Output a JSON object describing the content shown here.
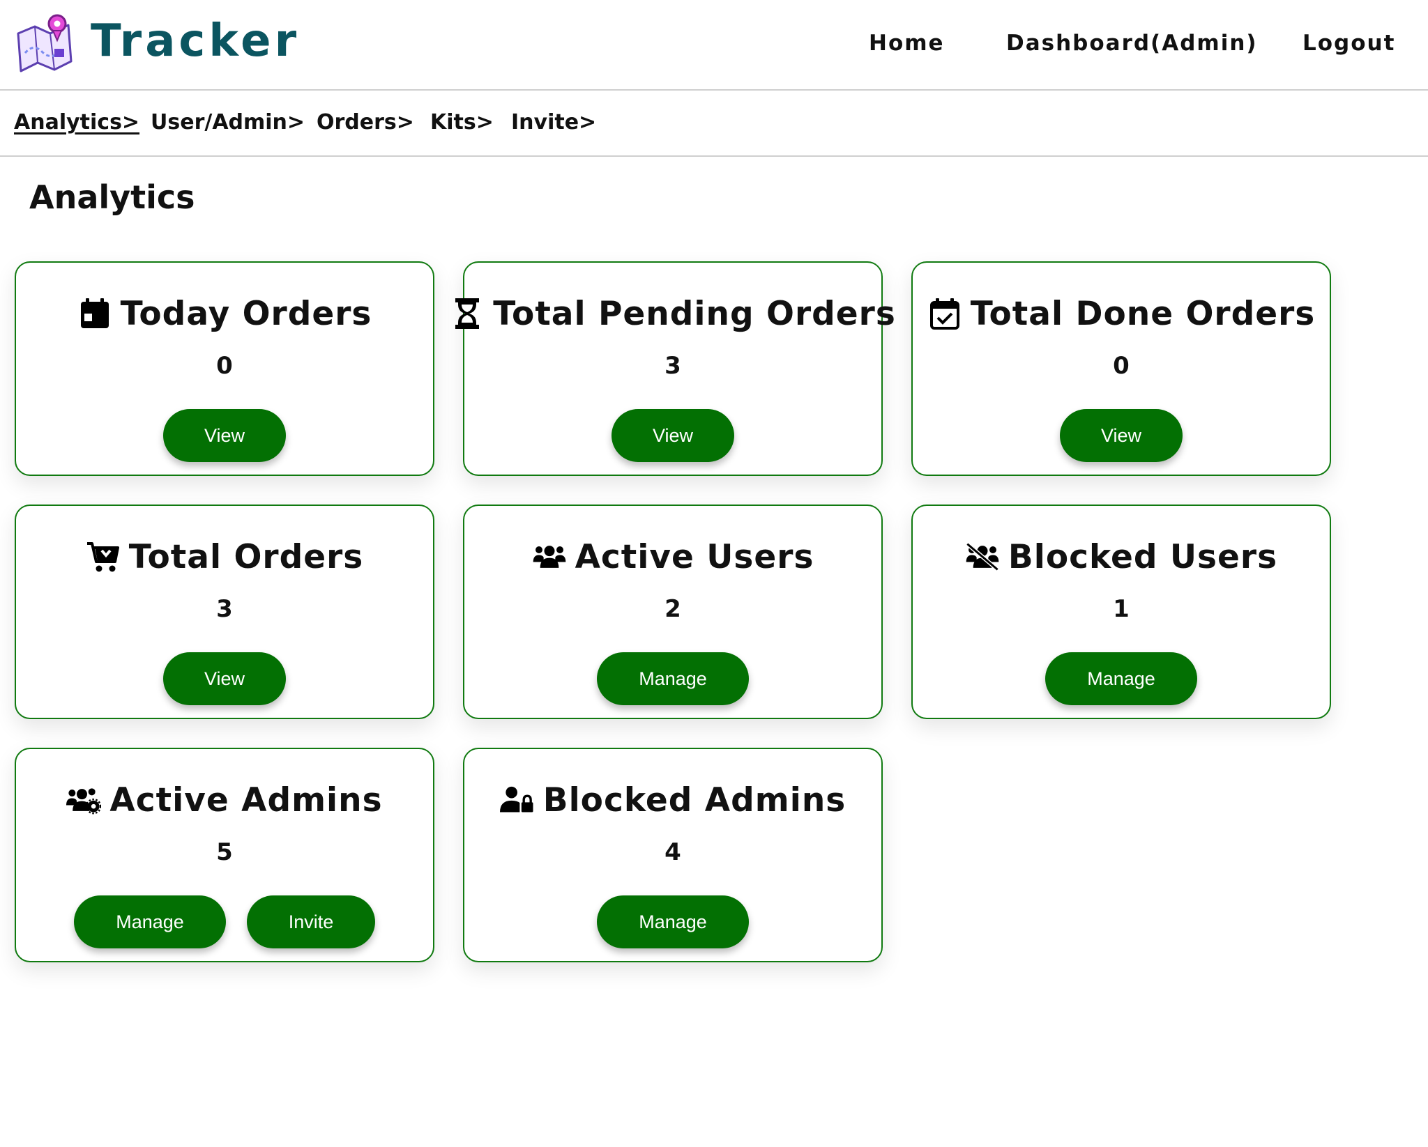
{
  "header": {
    "brand": "Tracker",
    "nav": [
      {
        "label": "Home"
      },
      {
        "label": "Dashboard(Admin)"
      },
      {
        "label": "Logout"
      }
    ]
  },
  "subnav": [
    {
      "label": "Analytics>",
      "active": true
    },
    {
      "label": "User/Admin>"
    },
    {
      "label": "Orders>"
    },
    {
      "label": "Kits>"
    },
    {
      "label": "Invite>"
    }
  ],
  "page": {
    "title": "Analytics"
  },
  "colors": {
    "accent": "#037003",
    "card_border": "#107a10",
    "brand": "#0b5560"
  },
  "cards": [
    {
      "icon": "calendar-day-icon",
      "title": "Today Orders",
      "value": "0",
      "buttons": [
        "View"
      ]
    },
    {
      "icon": "hourglass-icon",
      "title": "Total Pending Orders",
      "value": "3",
      "buttons": [
        "View"
      ]
    },
    {
      "icon": "calendar-check-icon",
      "title": "Total Done Orders",
      "value": "0",
      "buttons": [
        "View"
      ]
    },
    {
      "icon": "cart-icon",
      "title": "Total Orders",
      "value": "3",
      "buttons": [
        "View"
      ]
    },
    {
      "icon": "users-icon",
      "title": "Active Users",
      "value": "2",
      "buttons": [
        "Manage"
      ]
    },
    {
      "icon": "users-slash-icon",
      "title": "Blocked Users",
      "value": "1",
      "buttons": [
        "Manage"
      ]
    },
    {
      "icon": "users-gear-icon",
      "title": "Active Admins",
      "value": "5",
      "buttons": [
        "Manage",
        "Invite"
      ]
    },
    {
      "icon": "user-lock-icon",
      "title": "Blocked Admins",
      "value": "4",
      "buttons": [
        "Manage"
      ]
    }
  ]
}
